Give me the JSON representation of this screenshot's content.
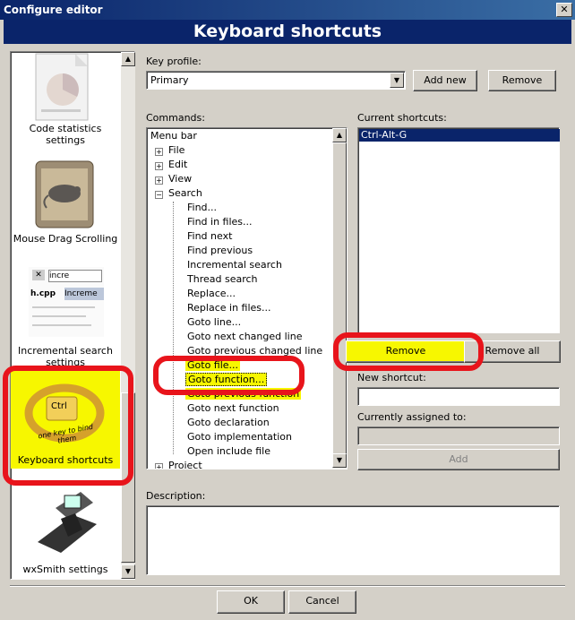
{
  "window": {
    "title": "Configure editor",
    "close_glyph": "✕"
  },
  "header": {
    "title": "Keyboard shortcuts"
  },
  "sidebar": {
    "items": [
      {
        "label": "Code statistics settings",
        "icon": "code-statistics-icon"
      },
      {
        "label": "Mouse Drag Scrolling",
        "icon": "mouse-scroll-icon"
      },
      {
        "label": "Incremental search settings",
        "icon": "incremental-search-icon",
        "preview_search": "incre",
        "preview_tab1": "h.cpp",
        "preview_tab2": "Increme"
      },
      {
        "label": "Keyboard shortcuts",
        "icon": "keyboard-icon",
        "selected": true,
        "icon_text": "Ctrl",
        "icon_caption": "one key to bind them"
      },
      {
        "label": "wxSmith settings",
        "icon": "wxsmith-icon"
      }
    ]
  },
  "key_profile": {
    "label": "Key profile:",
    "value": "Primary",
    "add_new": "Add new",
    "remove": "Remove"
  },
  "commands": {
    "label": "Commands:",
    "root": "Menu bar",
    "groups": [
      "File",
      "Edit",
      "View",
      "Search"
    ],
    "search_items": [
      "Find...",
      "Find in files...",
      "Find next",
      "Find previous",
      "Incremental search",
      "Thread search",
      "Replace...",
      "Replace in files...",
      "Goto line...",
      "Goto next changed line",
      "Goto previous changed line",
      "Goto file...",
      "Goto function...",
      "Goto previous function",
      "Goto next function",
      "Goto declaration",
      "Goto implementation",
      "Open include file"
    ],
    "selected": "Goto function...",
    "after_group": "Project"
  },
  "current_shortcuts": {
    "label": "Current shortcuts:",
    "items": [
      "Ctrl-Alt-G"
    ],
    "remove": "Remove",
    "remove_all": "Remove all"
  },
  "new_shortcut": {
    "label": "New shortcut:",
    "value": ""
  },
  "assigned": {
    "label": "Currently assigned to:",
    "value": "",
    "add": "Add"
  },
  "description": {
    "label": "Description:",
    "value": ""
  },
  "footer": {
    "ok": "OK",
    "cancel": "Cancel"
  },
  "colors": {
    "highlight": "#f7f700",
    "annotation": "#e8141b",
    "title_bg": "#0a246a"
  }
}
